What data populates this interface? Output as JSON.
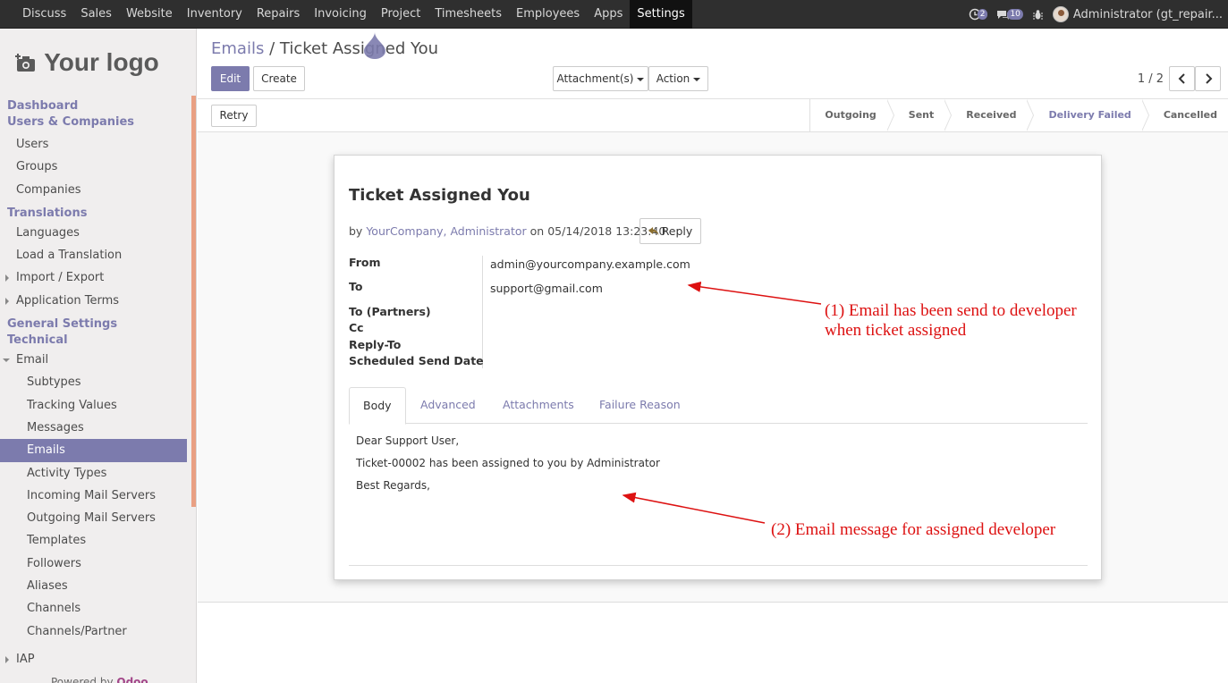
{
  "topbar": {
    "menu": [
      "Discuss",
      "Sales",
      "Website",
      "Inventory",
      "Repairs",
      "Invoicing",
      "Project",
      "Timesheets",
      "Employees",
      "Apps",
      "Settings"
    ],
    "active_menu": "Settings",
    "activity_count": "2",
    "message_count": "10",
    "user": "Administrator (gt_repair..."
  },
  "sidebar": {
    "logo_text": "Your logo",
    "sections": {
      "dashboard": "Dashboard",
      "users_companies": "Users & Companies",
      "translations": "Translations",
      "general_settings": "General Settings",
      "technical": "Technical"
    },
    "users_items": [
      "Users",
      "Groups",
      "Companies"
    ],
    "translation_items": [
      "Languages",
      "Load a Translation",
      "Import / Export",
      "Application Terms"
    ],
    "email_group": "Email",
    "email_items": [
      "Subtypes",
      "Tracking Values",
      "Messages",
      "Emails",
      "Activity Types",
      "Incoming Mail Servers",
      "Outgoing Mail Servers",
      "Templates",
      "Followers",
      "Aliases",
      "Channels",
      "Channels/Partner"
    ],
    "iap": "IAP",
    "powered_prefix": "Powered by",
    "powered_brand": "Odoo"
  },
  "control": {
    "breadcrumb_parent": "Emails",
    "breadcrumb_sep": "/",
    "breadcrumb_current": "Ticket Assigned You",
    "edit": "Edit",
    "create": "Create",
    "attachments": "Attachment(s)",
    "action": "Action",
    "pager": "1 / 2",
    "retry": "Retry"
  },
  "statusbar": [
    "Outgoing",
    "Sent",
    "Received",
    "Delivery Failed",
    "Cancelled"
  ],
  "statusbar_current": "Delivery Failed",
  "email": {
    "subject": "Ticket Assigned You",
    "by": "by",
    "author_company": "YourCompany,",
    "author": "Administrator",
    "on": "on",
    "date": "05/14/2018 13:23:40",
    "reply": "Reply",
    "fields": {
      "from_label": "From",
      "from_value": "admin@yourcompany.example.com",
      "to_label": "To",
      "to_value": "support@gmail.com",
      "to_partners_label": "To (Partners)",
      "cc_label": "Cc",
      "reply_to_label": "Reply-To",
      "scheduled_label": "Scheduled Send Date"
    },
    "tabs": [
      "Body",
      "Advanced",
      "Attachments",
      "Failure Reason"
    ],
    "active_tab": "Body",
    "body_lines": [
      "Dear Support User,",
      "Ticket-00002 has been assigned to you by Administrator",
      "Best Regards,"
    ]
  },
  "annotations": {
    "note1_line1": "(1) Email has been send to developer",
    "note1_line2": "when ticket assigned",
    "note2": "(2) Email message for assigned developer",
    "color": "#dd1111"
  },
  "colors": {
    "brand": "#7c7bad",
    "navbar": "#2f2f2f",
    "accent": "#e9a083"
  }
}
